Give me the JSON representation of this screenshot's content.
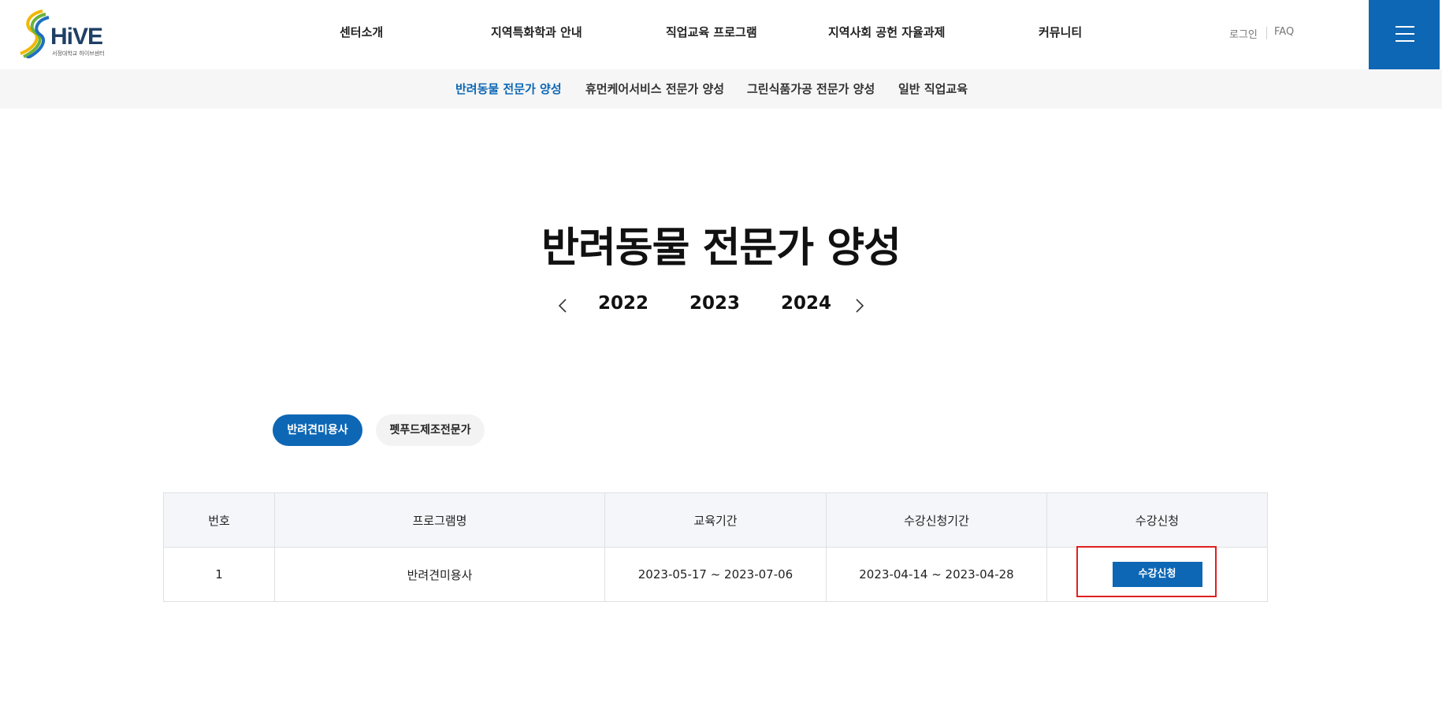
{
  "brand": {
    "name": "HiVE",
    "sub": "서정대학교 하이브센터",
    "colors": {
      "primary": "#0d67b5",
      "highlight": "#e02020"
    }
  },
  "gnb": {
    "items": [
      {
        "label": "센터소개"
      },
      {
        "label": "지역특화학과 안내"
      },
      {
        "label": "직업교육 프로그램"
      },
      {
        "label": "지역사회 공헌 자율과제"
      },
      {
        "label": "커뮤니티"
      }
    ]
  },
  "util": {
    "login": "로그인",
    "faq": "FAQ",
    "menu_icon": "hamburger-icon"
  },
  "subnav": {
    "items": [
      {
        "label": "반려동물 전문가 양성",
        "active": true
      },
      {
        "label": "휴먼케어서비스 전문가 양성"
      },
      {
        "label": "그린식품가공 전문가 양성"
      },
      {
        "label": "일반 직업교육"
      }
    ]
  },
  "page": {
    "title": "반려동물 전문가 양성"
  },
  "years": {
    "items": [
      "2022",
      "2023",
      "2024"
    ]
  },
  "tabs": {
    "items": [
      {
        "label": "반려견미용사",
        "active": true
      },
      {
        "label": "펫푸드제조전문가"
      }
    ]
  },
  "table": {
    "headers": [
      "번호",
      "프로그램명",
      "교육기간",
      "수강신청기간",
      "수강신청"
    ],
    "rows": [
      {
        "no": "1",
        "program": "반려견미용사",
        "period": "2023-05-17 ~ 2023-07-06",
        "apply_period": "2023-04-14 ~ 2023-04-28",
        "apply_label": "수강신청"
      }
    ]
  }
}
